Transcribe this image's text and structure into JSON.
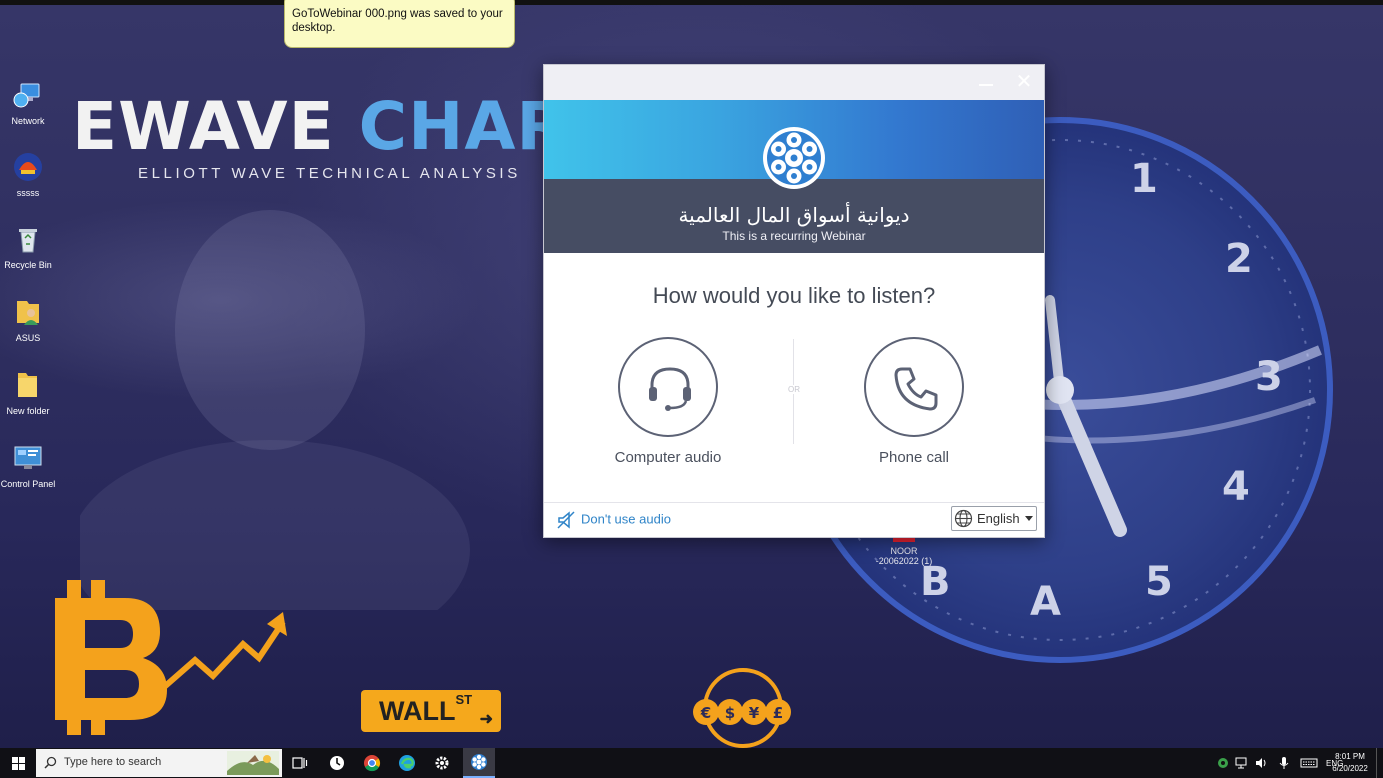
{
  "wallpaper": {
    "title_word1": "EWAVE",
    "title_word2": "CHART",
    "subtitle": "ELLIOTT WAVE TECHNICAL ANALYSIS",
    "clock_numbers": [
      "1",
      "2",
      "3",
      "4",
      "5",
      "A",
      "B"
    ],
    "wallst_label": "WALL",
    "wallst_sup": "ST",
    "currency_symbols": [
      "€",
      "$",
      "¥",
      "£"
    ]
  },
  "notification": {
    "text": "GoToWebinar 000.png was saved to your desktop."
  },
  "desktop_icons": [
    {
      "label": "Network",
      "icon": "network-icon"
    },
    {
      "label": "sssss",
      "icon": "app-icon"
    },
    {
      "label": "Recycle Bin",
      "icon": "recycle-bin-icon"
    },
    {
      "label": "ASUS",
      "icon": "user-folder-icon"
    },
    {
      "label": "New folder",
      "icon": "folder-icon"
    },
    {
      "label": "Control Panel",
      "icon": "control-panel-icon"
    }
  ],
  "desktop_file": {
    "line1": "NOOR",
    "line2": "-20062022 (1)"
  },
  "dialog": {
    "minimize_label": "",
    "close_label": "✕",
    "webinar_title": "ديوانية أسواق المال العالمية",
    "webinar_subtitle": "This is a recurring Webinar",
    "question": "How would you like to listen?",
    "option_computer": "Computer audio",
    "option_phone": "Phone call",
    "or_label": "OR",
    "dont_use_audio": "Don't use audio",
    "language": "English",
    "colors": {
      "accent": "#2f84c8",
      "header_bg": "#464d63",
      "logo_blue": "#2f7fd0"
    }
  },
  "taskbar": {
    "search_placeholder": "Type here to search",
    "apps": [
      "task-view-icon",
      "clock-app-icon",
      "chrome-icon",
      "edge-icon",
      "settings-icon",
      "gotowebinar-icon"
    ],
    "language": "ENG",
    "time": "8:01 PM",
    "date": "6/20/2022"
  }
}
